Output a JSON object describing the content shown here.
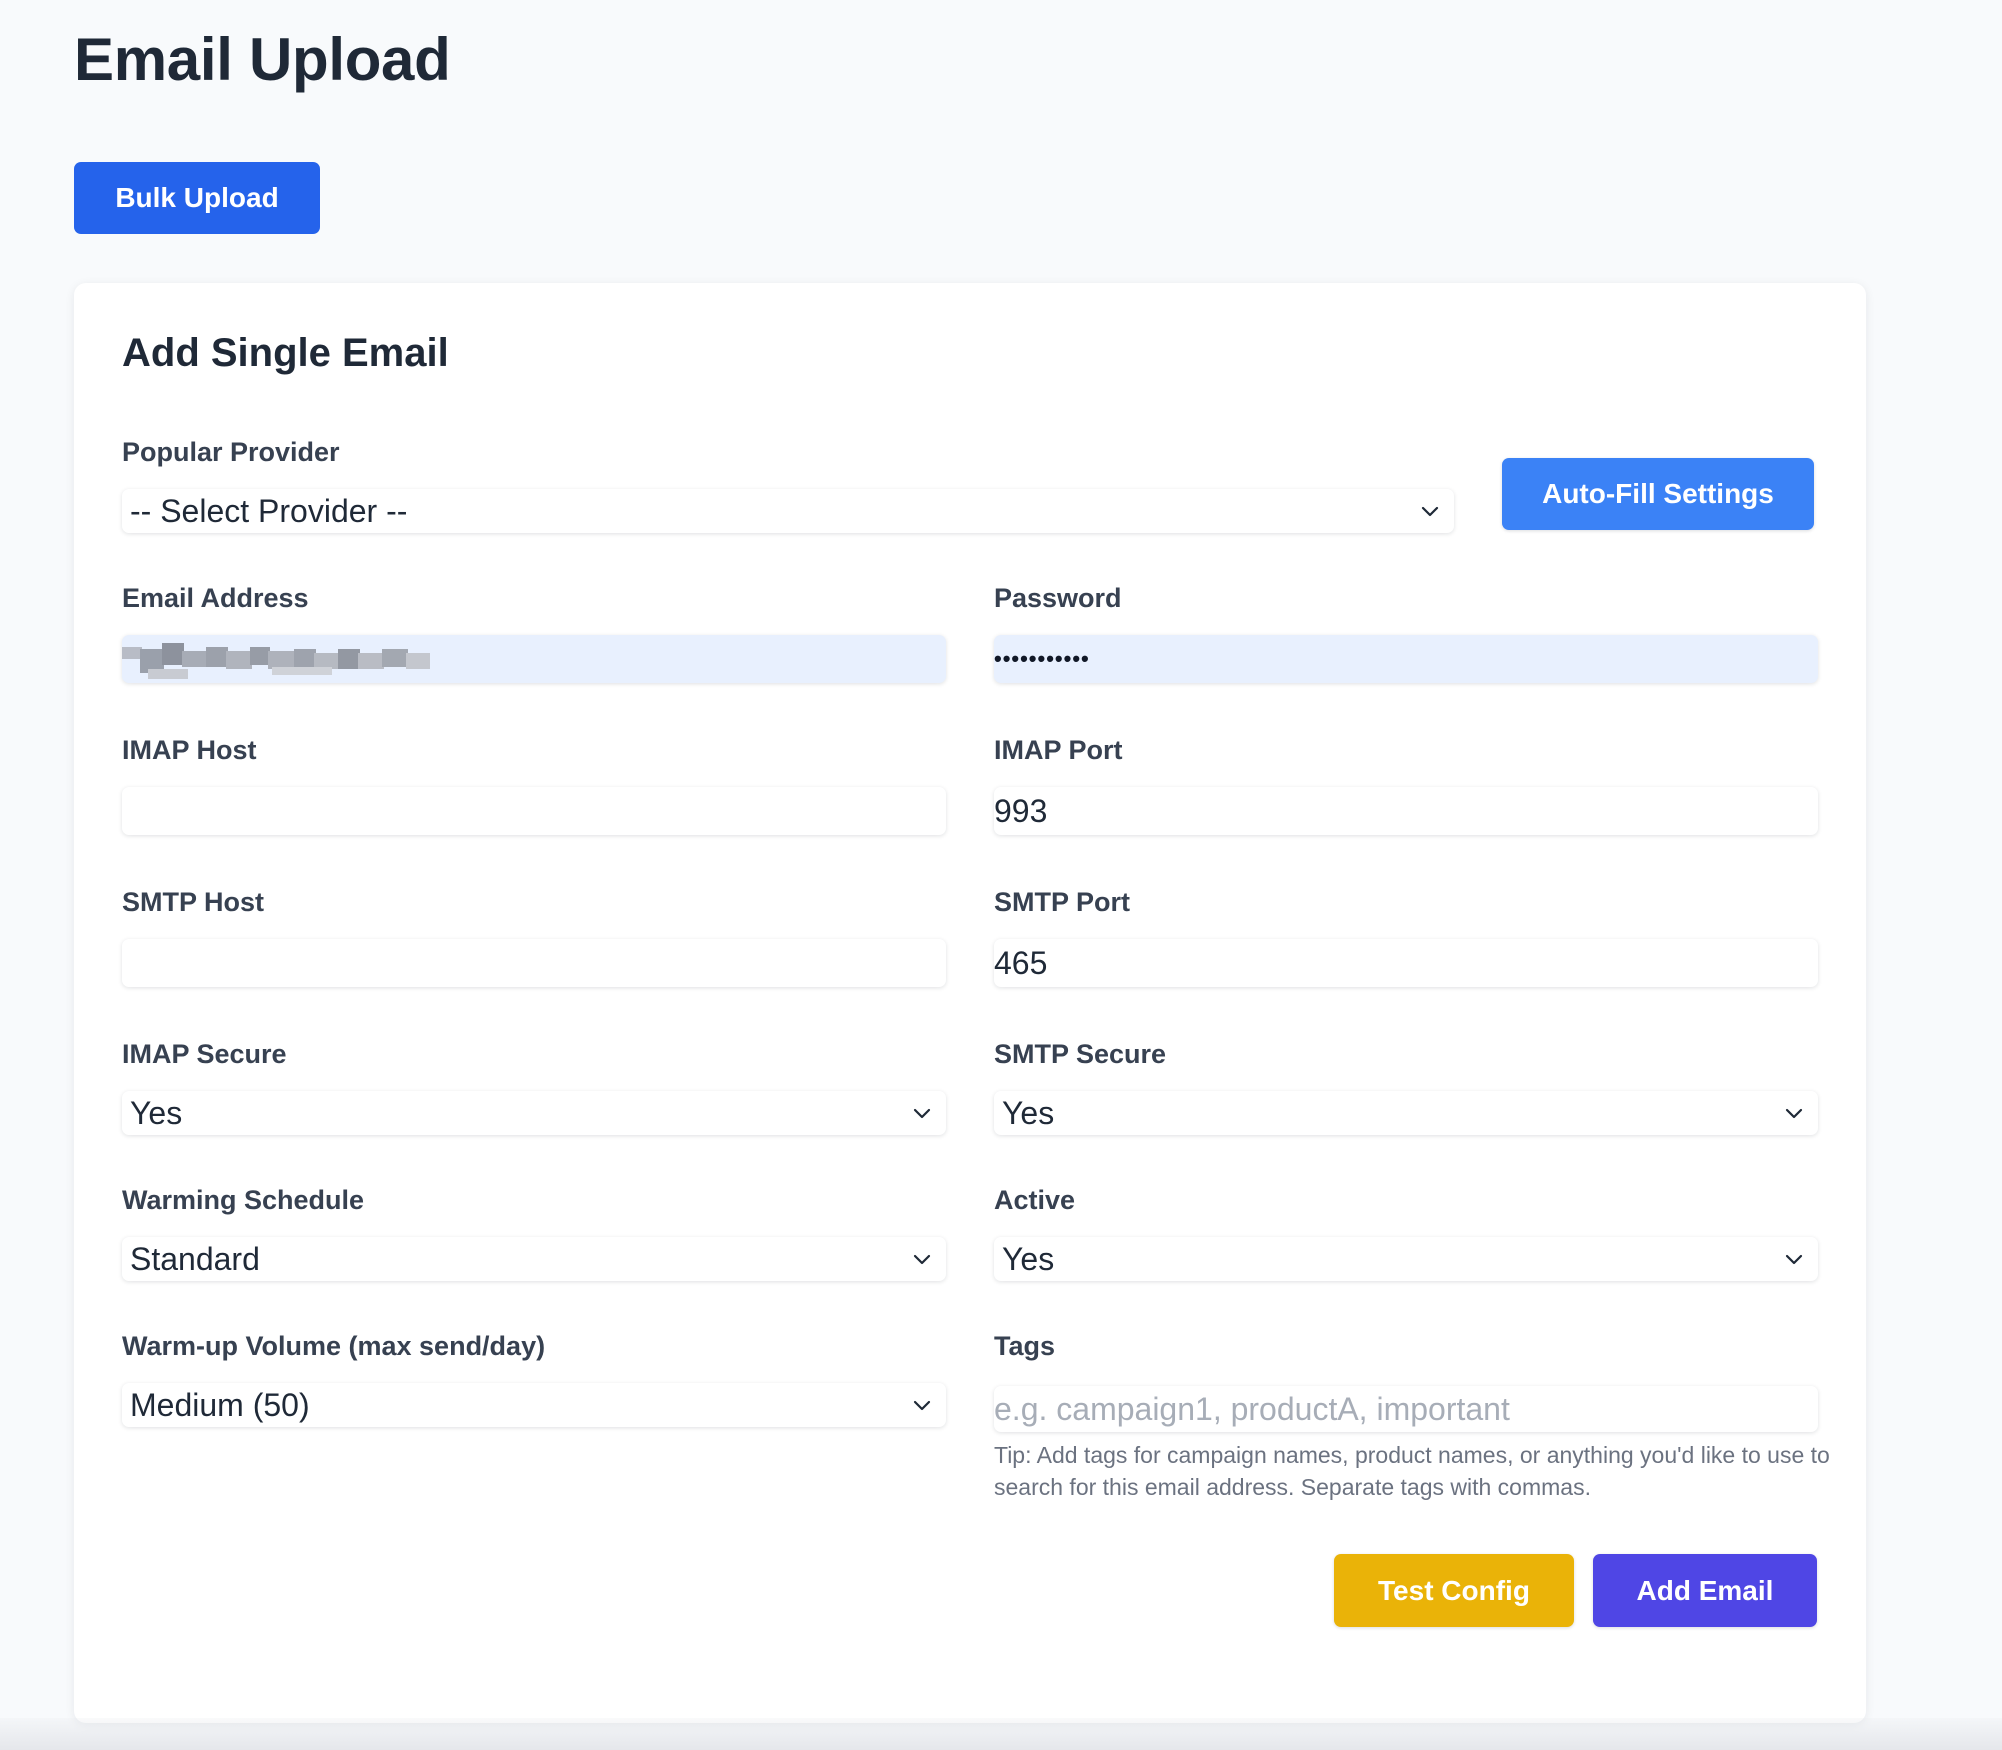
{
  "page": {
    "title": "Email Upload",
    "bulk_upload_label": "Bulk Upload"
  },
  "form": {
    "title": "Add Single Email",
    "provider": {
      "label": "Popular Provider",
      "value": "-- Select Provider --"
    },
    "autofill_label": "Auto-Fill Settings",
    "email": {
      "label": "Email Address",
      "value": ""
    },
    "password": {
      "label": "Password",
      "value": "•••••••••••"
    },
    "imap_host": {
      "label": "IMAP Host",
      "value": ""
    },
    "imap_port": {
      "label": "IMAP Port",
      "value": "993"
    },
    "smtp_host": {
      "label": "SMTP Host",
      "value": ""
    },
    "smtp_port": {
      "label": "SMTP Port",
      "value": "465"
    },
    "imap_secure": {
      "label": "IMAP Secure",
      "value": "Yes"
    },
    "smtp_secure": {
      "label": "SMTP Secure",
      "value": "Yes"
    },
    "warming_schedule": {
      "label": "Warming Schedule",
      "value": "Standard"
    },
    "active": {
      "label": "Active",
      "value": "Yes"
    },
    "warmup_volume": {
      "label": "Warm-up Volume (max send/day)",
      "value": "Medium (50)"
    },
    "tags": {
      "label": "Tags",
      "placeholder": "e.g. campaign1, productA, important",
      "tip": "Tip: Add tags for campaign names, product names, or anything you'd like to use to search for this email address. Separate tags with commas."
    },
    "test_config_label": "Test Config",
    "add_email_label": "Add Email"
  },
  "colors": {
    "primary": "#2563eb",
    "autofill": "#3b82f6",
    "test_config": "#eab308",
    "add_email": "#4f46e5",
    "autofilled_field": "#e8f0fe",
    "background": "#f8fafc"
  }
}
